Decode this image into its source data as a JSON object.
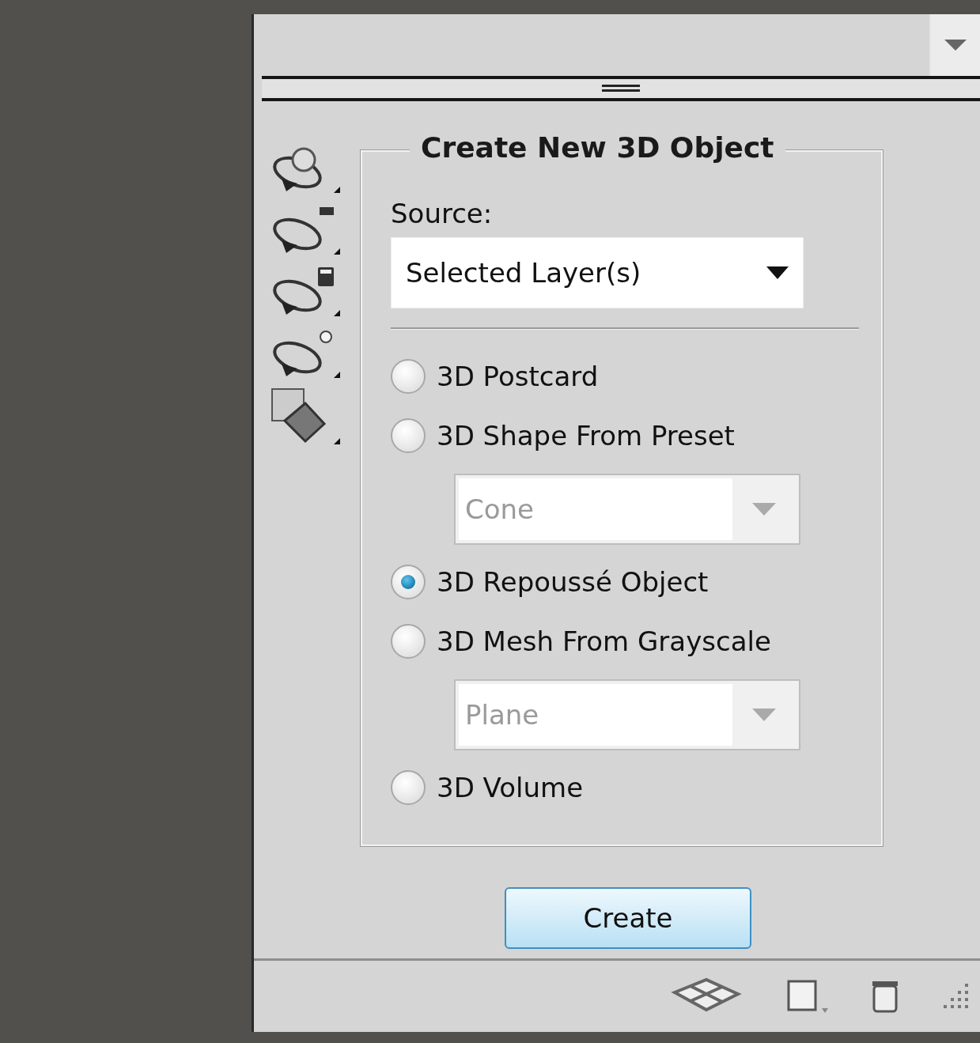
{
  "panel": {
    "section_title": "Create New 3D Object",
    "source_label": "Source:",
    "source_value": "Selected Layer(s)",
    "options": [
      {
        "label": "3D Postcard",
        "selected": false
      },
      {
        "label": "3D Shape From Preset",
        "selected": false,
        "preset": {
          "value": "Cone",
          "disabled": true
        }
      },
      {
        "label": "3D Repoussé Object",
        "selected": true
      },
      {
        "label": "3D Mesh From Grayscale",
        "selected": false,
        "preset": {
          "value": "Plane",
          "disabled": true
        }
      },
      {
        "label": "3D Volume",
        "selected": false
      }
    ],
    "create_button": "Create"
  }
}
